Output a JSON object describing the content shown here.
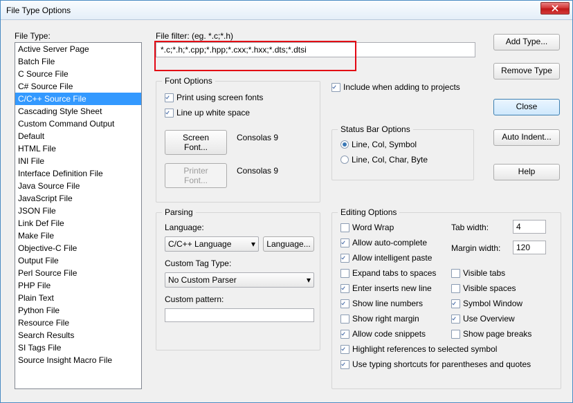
{
  "window": {
    "title": "File Type Options"
  },
  "file_type": {
    "label": "File Type:",
    "items": [
      "Active Server Page",
      "Batch File",
      "C Source File",
      "C# Source File",
      "C/C++ Source File",
      "Cascading Style Sheet",
      "Custom Command Output",
      "Default",
      "HTML File",
      "INI File",
      "Interface Definition File",
      "Java Source File",
      "JavaScript File",
      "JSON File",
      "Link Def File",
      "Make File",
      "Objective-C File",
      "Output File",
      "Perl Source File",
      "PHP File",
      "Plain Text",
      "Python File",
      "Resource File",
      "Search Results",
      "SI Tags File",
      "Source Insight Macro File"
    ],
    "selected_index": 4
  },
  "file_filter": {
    "label": "File filter: (eg. *.c;*.h)",
    "value": "*.c;*.h;*.cpp;*.hpp;*.cxx;*.hxx;*.dts;*.dtsi"
  },
  "font_options": {
    "legend": "Font Options",
    "print_using_screen_fonts": {
      "label": "Print using screen fonts",
      "checked": true
    },
    "line_up_white_space": {
      "label": "Line up white space",
      "checked": true
    },
    "screen_font_btn": "Screen Font...",
    "screen_font_value": "Consolas 9",
    "printer_font_btn": "Printer Font...",
    "printer_font_value": "Consolas 9"
  },
  "include_projects": {
    "label": "Include when adding to projects",
    "checked": true
  },
  "status_bar": {
    "legend": "Status Bar Options",
    "opt1": "Line, Col, Symbol",
    "opt2": "Line, Col, Char, Byte",
    "selected": 0
  },
  "parsing": {
    "legend": "Parsing",
    "language_label": "Language:",
    "language_value": "C/C++ Language",
    "language_btn": "Language...",
    "custom_tag_label": "Custom Tag Type:",
    "custom_tag_value": "No Custom Parser",
    "custom_pattern_label": "Custom pattern:",
    "custom_pattern_value": ""
  },
  "editing": {
    "legend": "Editing Options",
    "word_wrap": {
      "label": "Word Wrap",
      "checked": false
    },
    "auto_complete": {
      "label": "Allow auto-complete",
      "checked": true
    },
    "intelligent_paste": {
      "label": "Allow intelligent paste",
      "checked": true
    },
    "expand_tabs": {
      "label": "Expand tabs to spaces",
      "checked": false
    },
    "enter_newline": {
      "label": "Enter inserts new line",
      "checked": true
    },
    "line_numbers": {
      "label": "Show line numbers",
      "checked": true
    },
    "right_margin": {
      "label": "Show right margin",
      "checked": false
    },
    "code_snippets": {
      "label": "Allow code snippets",
      "checked": true
    },
    "highlight_refs": {
      "label": "Highlight references to selected symbol",
      "checked": true
    },
    "typing_shortcuts": {
      "label": "Use typing shortcuts for parentheses and quotes",
      "checked": true
    },
    "tab_width": {
      "label": "Tab width:",
      "value": "4"
    },
    "margin_width": {
      "label": "Margin width:",
      "value": "120"
    },
    "visible_tabs": {
      "label": "Visible tabs",
      "checked": false
    },
    "visible_spaces": {
      "label": "Visible spaces",
      "checked": false
    },
    "symbol_window": {
      "label": "Symbol Window",
      "checked": true
    },
    "use_overview": {
      "label": "Use Overview",
      "checked": true
    },
    "page_breaks": {
      "label": "Show page breaks",
      "checked": false
    }
  },
  "buttons": {
    "add_type": "Add Type...",
    "remove_type": "Remove Type",
    "close": "Close",
    "auto_indent": "Auto Indent...",
    "help": "Help"
  }
}
